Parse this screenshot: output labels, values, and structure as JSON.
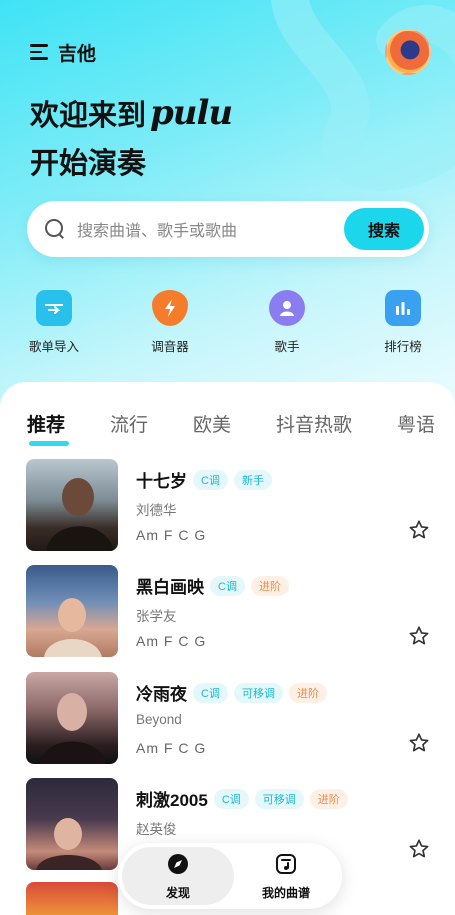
{
  "header": {
    "title": "吉他",
    "welcome_prefix": "欢迎来到",
    "brand": "pulu",
    "welcome_line2": "开始演奏"
  },
  "search": {
    "placeholder": "搜索曲谱、歌手或歌曲",
    "button_label": "搜索"
  },
  "quick_actions": [
    {
      "label": "歌单导入",
      "icon": "folder-import-icon",
      "color": "#29c1ec"
    },
    {
      "label": "调音器",
      "icon": "bolt-shield-icon",
      "color": "#f47c2a"
    },
    {
      "label": "歌手",
      "icon": "user-icon",
      "color": "#8b7cf0"
    },
    {
      "label": "排行榜",
      "icon": "bar-chart-icon",
      "color": "#3aa0f0"
    }
  ],
  "tabs": [
    {
      "label": "推荐",
      "active": true
    },
    {
      "label": "流行",
      "active": false
    },
    {
      "label": "欧美",
      "active": false
    },
    {
      "label": "抖音热歌",
      "active": false
    },
    {
      "label": "粤语",
      "active": false
    }
  ],
  "songs": [
    {
      "title": "十七岁",
      "tags": [
        {
          "text": "C调",
          "kind": "key"
        },
        {
          "text": "新手",
          "kind": "key"
        }
      ],
      "artist": "刘德华",
      "chords": "Am F C G"
    },
    {
      "title": "黑白画映",
      "tags": [
        {
          "text": "C调",
          "kind": "key"
        },
        {
          "text": "进阶",
          "kind": "level"
        }
      ],
      "artist": "张学友",
      "chords": "Am F C G"
    },
    {
      "title": "冷雨夜",
      "tags": [
        {
          "text": "C调",
          "kind": "key"
        },
        {
          "text": "可移调",
          "kind": "key"
        },
        {
          "text": "进阶",
          "kind": "level"
        }
      ],
      "artist": "Beyond",
      "chords": "Am F C G"
    },
    {
      "title": "刺激2005",
      "tags": [
        {
          "text": "C调",
          "kind": "key"
        },
        {
          "text": "可移调",
          "kind": "key"
        },
        {
          "text": "进阶",
          "kind": "level"
        }
      ],
      "artist": "赵英俊",
      "chords": ""
    }
  ],
  "nav": {
    "discover_label": "发现",
    "mysheets_label": "我的曲谱"
  },
  "colors": {
    "accent": "#1cd6ec",
    "level": "#ef8b4e"
  }
}
